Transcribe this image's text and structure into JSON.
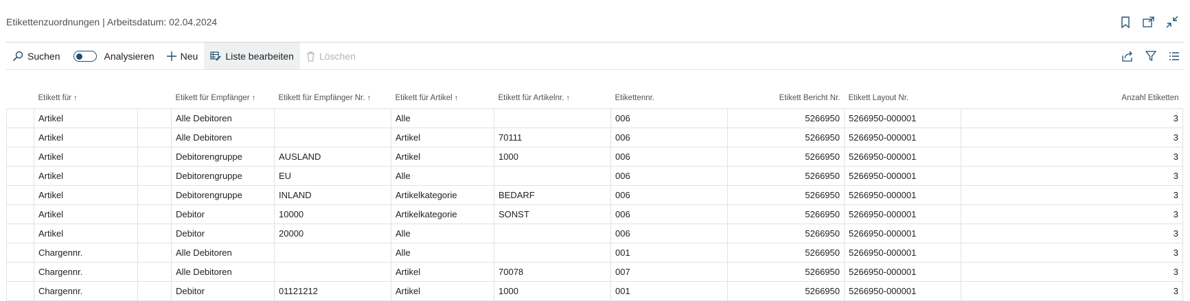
{
  "page": {
    "title": "Etikettenzuordnungen | Arbeitsdatum: 02.04.2024"
  },
  "title_icons": [
    "bookmark-icon",
    "open-new-window-icon",
    "collapse-icon"
  ],
  "actions": {
    "search": "Suchen",
    "analyze": "Analysieren",
    "new": "Neu",
    "edit_list": "Liste bearbeiten",
    "delete": "Löschen"
  },
  "right_icons": [
    "share-icon",
    "filter-icon",
    "list-view-icon"
  ],
  "accent_color": "#1b4f72",
  "table": {
    "headers": [
      "Etikett für",
      "Etikett für Empfänger",
      "Etikett für Empfänger Nr.",
      "Etikett für Artikel",
      "Etikett für Artikelnr.",
      "Etikettennr.",
      "Etikett Bericht Nr.",
      "Etikett Layout Nr.",
      "Anzahl Etiketten"
    ],
    "sort_indicator": "↑",
    "rows": [
      [
        "Artikel",
        "Alle Debitoren",
        "",
        "Alle",
        "",
        "006",
        "5266950",
        "5266950-000001",
        "3"
      ],
      [
        "Artikel",
        "Alle Debitoren",
        "",
        "Artikel",
        "70111",
        "006",
        "5266950",
        "5266950-000001",
        "3"
      ],
      [
        "Artikel",
        "Debitorengruppe",
        "AUSLAND",
        "Artikel",
        "1000",
        "006",
        "5266950",
        "5266950-000001",
        "3"
      ],
      [
        "Artikel",
        "Debitorengruppe",
        "EU",
        "Alle",
        "",
        "006",
        "5266950",
        "5266950-000001",
        "3"
      ],
      [
        "Artikel",
        "Debitorengruppe",
        "INLAND",
        "Artikelkategorie",
        "BEDARF",
        "006",
        "5266950",
        "5266950-000001",
        "3"
      ],
      [
        "Artikel",
        "Debitor",
        "10000",
        "Artikelkategorie",
        "SONST",
        "006",
        "5266950",
        "5266950-000001",
        "3"
      ],
      [
        "Artikel",
        "Debitor",
        "20000",
        "Alle",
        "",
        "006",
        "5266950",
        "5266950-000001",
        "3"
      ],
      [
        "Chargennr.",
        "Alle Debitoren",
        "",
        "Alle",
        "",
        "001",
        "5266950",
        "5266950-000001",
        "3"
      ],
      [
        "Chargennr.",
        "Alle Debitoren",
        "",
        "Artikel",
        "70078",
        "007",
        "5266950",
        "5266950-000001",
        "3"
      ],
      [
        "Chargennr.",
        "Debitor",
        "01121212",
        "Artikel",
        "1000",
        "001",
        "5266950",
        "5266950-000001",
        "3"
      ]
    ]
  }
}
